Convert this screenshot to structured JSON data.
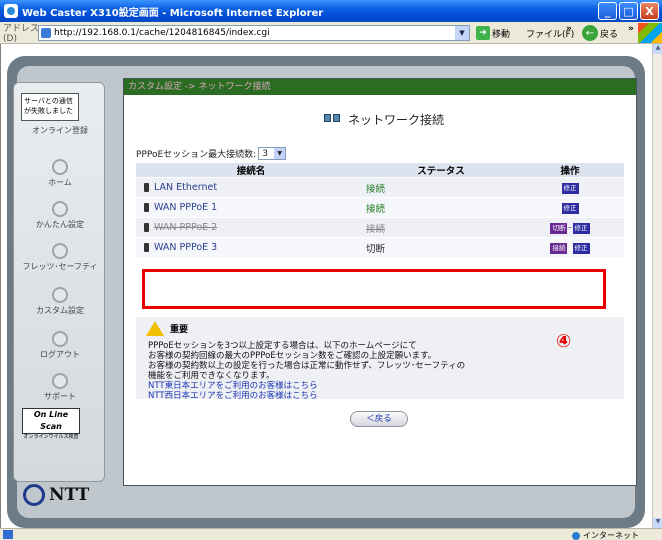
{
  "window": {
    "title": "Web Caster X310設定画面 - Microsoft Internet Explorer",
    "buttons": {
      "minimize": "_",
      "maximize": "□",
      "close": "X"
    }
  },
  "addressbar": {
    "label": "アドレス(D)",
    "url": "http://192.168.0.1/cache/1204816845/index.cgi",
    "go_label": "移動",
    "file_menu": "ファイル(F)",
    "back_label": "戻る",
    "chevron": "»"
  },
  "sidebar": {
    "notice": "サーバとの通信が失敗しました",
    "items": [
      {
        "label": "オンライン登録"
      },
      {
        "label": "ホーム"
      },
      {
        "label": "かんたん設定"
      },
      {
        "label": "フレッツ･セーフティ"
      },
      {
        "label": "カスタム設定"
      },
      {
        "label": "ログアウト"
      },
      {
        "label": "サポート"
      }
    ],
    "onlinescan": {
      "title": "On Line Scan",
      "sub": "オンラインウイルス検査"
    },
    "logo": "NTT"
  },
  "content": {
    "breadcrumb": "カスタム設定 -> ネットワーク接続",
    "heading": "ネットワーク接続",
    "pppoe_label": "PPPoEセッション最大接続数:",
    "pppoe_max": "3",
    "table": {
      "headers": [
        "接続名",
        "ステータス",
        "操作"
      ],
      "rows": [
        {
          "name": "LAN Ethernet",
          "status": "接続",
          "status_type": "on",
          "ops": [
            "修正"
          ]
        },
        {
          "name": "WAN PPPoE 1",
          "status": "接続",
          "status_type": "on",
          "ops": [
            "修正"
          ]
        },
        {
          "name": "WAN PPPoE 2",
          "status": "接続",
          "status_type": "on",
          "ops": [
            "切断",
            "修正"
          ]
        },
        {
          "name": "WAN PPPoE 3",
          "status": "切断",
          "status_type": "off",
          "ops": [
            "接続",
            "修正"
          ]
        }
      ]
    },
    "annotation": "④",
    "warning": {
      "title": "重要",
      "lines": [
        "PPPoEセッションを3つ以上設定する場合は、以下のホームページにて",
        "お客様の契約回線の最大のPPPoEセッション数をご確認の上設定願います。",
        "お客様の契約数以上の設定を行った場合は正常に動作せず、フレッツ･セーフティの",
        "機能をご利用できなくなります。"
      ],
      "links": [
        "NTT東日本エリアをご利用のお客様はこちら",
        "NTT西日本エリアをご利用のお客様はこちら"
      ]
    },
    "back_button": "＜戻る"
  },
  "statusbar": {
    "zone": "インターネット"
  }
}
